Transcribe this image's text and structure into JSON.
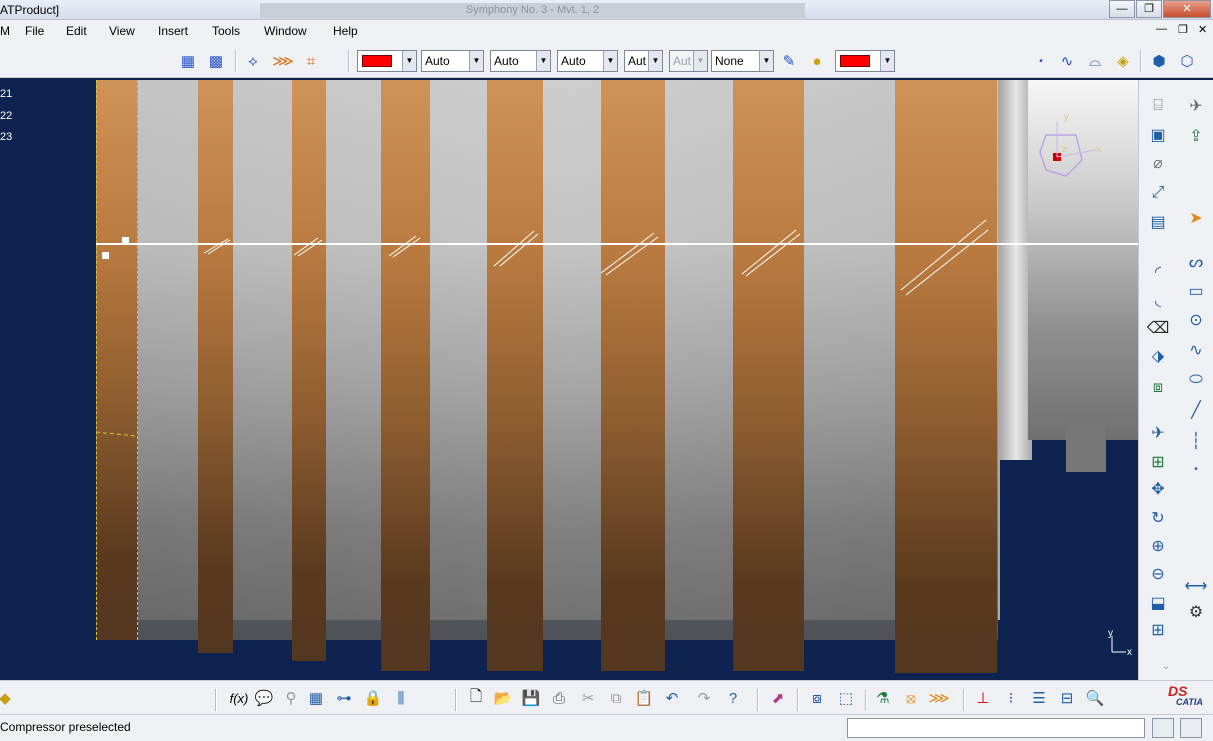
{
  "window": {
    "title_left": "ATProduct]",
    "title_center": "Symphony No. 3 - Mvt. 1, 2",
    "minimize": "—",
    "restore": "❐",
    "close": "✕"
  },
  "menubar": {
    "items": [
      {
        "label": "M"
      },
      {
        "label": "File"
      },
      {
        "label": "Edit"
      },
      {
        "label": "View"
      },
      {
        "label": "Insert"
      },
      {
        "label": "Tools"
      },
      {
        "label": "Window"
      },
      {
        "label": "Help"
      }
    ],
    "doc_minimize": "—",
    "doc_restore": "❐",
    "doc_close": "✕"
  },
  "toolbar": {
    "fill_color": "#ff0000",
    "line_thickness": "Auto",
    "line_type": "Auto",
    "line_weight": "Auto",
    "point_type": "Aut",
    "layer_disabled": "Aut",
    "layer": "None",
    "line_color": "#ff0000"
  },
  "tree": {
    "items": [
      {
        "label": "21"
      },
      {
        "label": "22"
      },
      {
        "label": "23"
      }
    ]
  },
  "viewport": {
    "background": "#0f2350",
    "copper_color": "#b97a3f",
    "axis_y": "y",
    "axis_x": "x",
    "compass_y": "y",
    "compass_x": "x",
    "compass_z": "z"
  },
  "statusbar": {
    "message": "Compressor preselected",
    "command_value": ""
  },
  "bottom_toolbar": {
    "formula_label": "f(x)"
  },
  "brand": {
    "logo_text": "CATIA"
  }
}
